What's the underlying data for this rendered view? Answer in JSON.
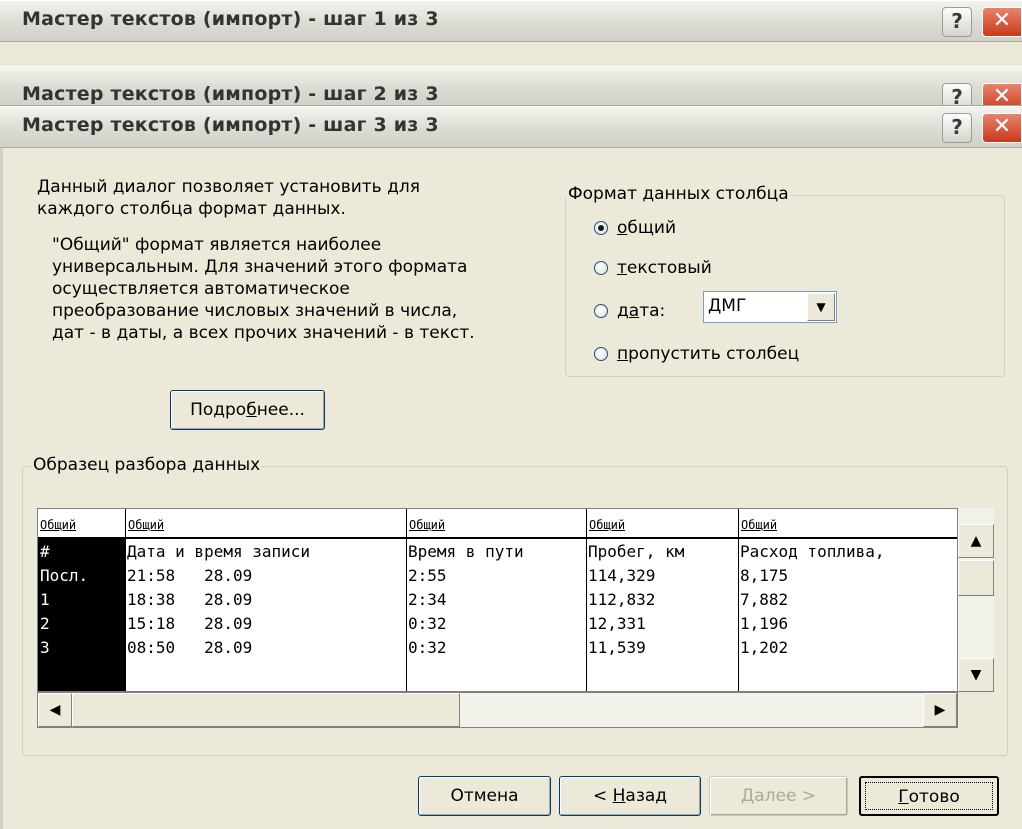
{
  "windows": {
    "step1_title": "Мастер текстов (импорт) - шаг 1 из 3",
    "step2_title": "Мастер текстов (импорт) - шаг 2 из 3",
    "step3_title": "Мастер текстов (импорт) - шаг 3 из 3"
  },
  "titlebar": {
    "help_glyph": "?",
    "close_glyph": "✕"
  },
  "description": {
    "line1": "Данный диалог позволяет установить для",
    "line2": "каждого столбца формат данных.",
    "para2_line1": "\"Общий\" формат является наиболее",
    "para2_line2": "универсальным. Для значений этого формата",
    "para2_line3": "осуществляется автоматическое",
    "para2_line4": "преобразование числовых значений в числа,",
    "para2_line5": "дат - в даты, а всех прочих значений - в текст."
  },
  "details_button": {
    "pre": "Подро",
    "accel": "б",
    "post": "нее..."
  },
  "column_format": {
    "legend": "Формат данных столбца",
    "general": {
      "accel": "о",
      "rest": "бщий",
      "selected": true
    },
    "text": {
      "accel": "т",
      "rest": "екстовый"
    },
    "date": {
      "pre": "д",
      "accel": "а",
      "post": "та:"
    },
    "skip": {
      "accel": "п",
      "rest": "ропустить столбец"
    },
    "date_format_value": "ДМГ"
  },
  "preview": {
    "legend": "Образец разбора данных",
    "headers": [
      "Общий",
      "Общий",
      "Общий",
      "Общий",
      "Общий"
    ],
    "rows": [
      [
        "#",
        "Дата и время записи",
        "Время в пути",
        "Пробег, км",
        "Расход топлива,"
      ],
      [
        "Посл.",
        "21:58   28.09",
        "2:55",
        "114,329",
        "8,175"
      ],
      [
        "1",
        "18:38   28.09",
        "2:34",
        "112,832",
        "7,882"
      ],
      [
        "2",
        "15:18   28.09",
        "0:32",
        "12,331",
        "1,196"
      ],
      [
        "3",
        "08:50   28.09",
        "0:32",
        "11,539",
        "1,202"
      ]
    ]
  },
  "buttons": {
    "cancel": "Отмена",
    "back_pre": "< ",
    "back_accel": "Н",
    "back_post": "азад",
    "next": "Далее >",
    "finish_accel": "Г",
    "finish_post": "отово"
  },
  "scroll_glyphs": {
    "up": "▲",
    "down": "▼",
    "left": "◀",
    "right": "▶",
    "combo_down": "▼"
  }
}
